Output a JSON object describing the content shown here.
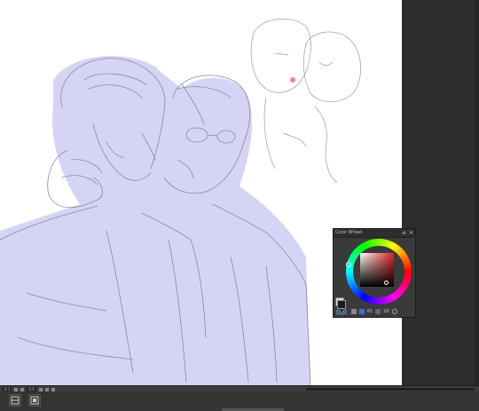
{
  "palette": {
    "title": "Color Wheel",
    "close_symbol": "✕",
    "menu_symbol": "≡",
    "selected_hue_hex": "#e02424",
    "main_color_hex": "#1a1a1a",
    "sub_color_hex": "#d8d8d8",
    "status": {
      "value_a": "61",
      "value_b": "20"
    }
  },
  "statusbar": {
    "zoom_value": "0.1",
    "angle_value": "0.0"
  },
  "colors": {
    "canvas_bg": "#ffffff",
    "workspace_bg": "#2c2c2c",
    "fill_tint": "#d6d4f4",
    "line_color": "#8a8a9a"
  },
  "toolbar": {
    "icons": [
      "layer-panel-icon",
      "navigator-icon"
    ]
  }
}
